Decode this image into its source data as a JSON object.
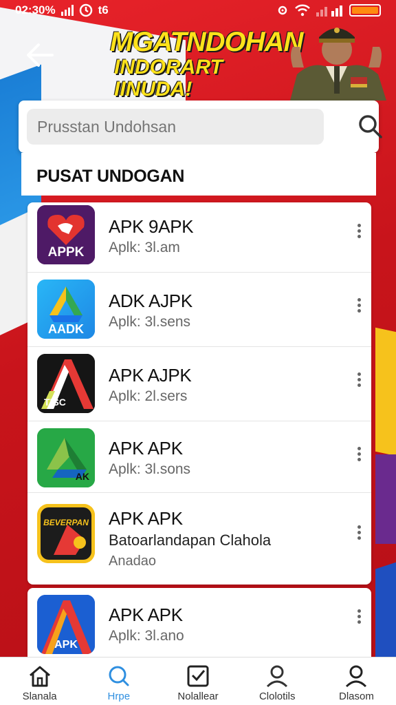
{
  "status_bar": {
    "time": "02:30%",
    "left_extra": "t6"
  },
  "header": {
    "banner_line1": "MGATNDOHAN",
    "banner_line2": "INDORART IINUDA!"
  },
  "search": {
    "placeholder": "Prusstan Undohsan"
  },
  "section": {
    "title": "PUSAT UNDOGAN"
  },
  "apps": [
    {
      "name": "APK 9APK",
      "subtitle": "Aplk: 3l.am",
      "icon": "apk-logo-heart-icon",
      "icon_text": "APPK"
    },
    {
      "name": "ADK AJPK",
      "subtitle": "Aplk: 3l.sens",
      "icon": "drive-triangle-icon",
      "icon_text": "AADK"
    },
    {
      "name": "APK AJPK",
      "subtitle": "Aplk: 2l.sers",
      "icon": "letter-a-dark-icon",
      "icon_text": "TISC"
    },
    {
      "name": "APK APK",
      "subtitle": "Aplk: 3l.sons",
      "icon": "green-drive-icon",
      "icon_text": "AK"
    },
    {
      "name": "APK APK",
      "subtitle": "Batoarlandapan Clahola",
      "subtitle2": "Anadao",
      "icon": "game-badge-icon",
      "icon_text": "BEVERPAN"
    },
    {
      "name": "APK APK",
      "subtitle": "Aplk: 3l.ano",
      "icon": "letter-a-blue-icon",
      "icon_text": "APK"
    }
  ],
  "nav": [
    {
      "label": "Slanala",
      "icon": "home-icon"
    },
    {
      "label": "Hrpe",
      "icon": "search-icon",
      "active": true
    },
    {
      "label": "Nolallear",
      "icon": "inbox-check-icon"
    },
    {
      "label": "Clolotils",
      "icon": "person-icon"
    },
    {
      "label": "Dlasom",
      "icon": "profile-icon"
    }
  ],
  "colors": {
    "accent": "#2f8fe0",
    "battery": "#ff8a10",
    "banner_text": "#ffe21a",
    "background_red": "#c8181e"
  }
}
